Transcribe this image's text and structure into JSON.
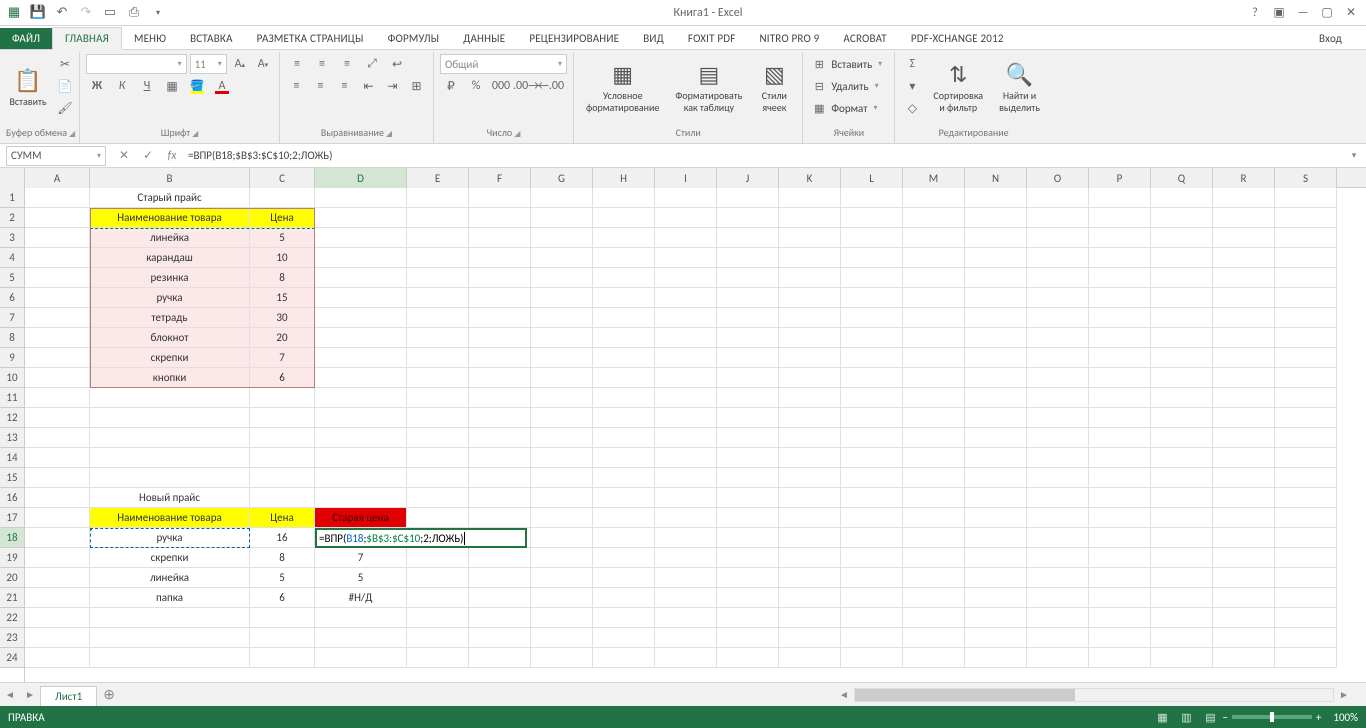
{
  "app": {
    "title": "Книга1 - Excel"
  },
  "qat": [
    "excel",
    "save",
    "undo",
    "redo",
    "doc",
    "print",
    "dd"
  ],
  "wincontrols": [
    "help",
    "ribbon-toggle",
    "minimize",
    "restore",
    "close"
  ],
  "tabs": {
    "file": "ФАЙЛ",
    "items": [
      "ГЛАВНАЯ",
      "Меню",
      "ВСТАВКА",
      "РАЗМЕТКА СТРАНИЦЫ",
      "ФОРМУЛЫ",
      "ДАННЫЕ",
      "РЕЦЕНЗИРОВАНИЕ",
      "ВИД",
      "Foxit PDF",
      "NITRO PRO 9",
      "ACROBAT",
      "PDF-XChange 2012"
    ],
    "active": "ГЛАВНАЯ",
    "login": "Вход"
  },
  "ribbon": {
    "clipboard": {
      "paste": "Вставить",
      "label": "Буфер обмена"
    },
    "font": {
      "label": "Шрифт",
      "size": "11",
      "fontname": ""
    },
    "alignment": {
      "label": "Выравнивание"
    },
    "number": {
      "label": "Число",
      "format": "Общий"
    },
    "styles": {
      "label": "Стили",
      "cond": "Условное\nформатирование",
      "table": "Форматировать\nкак таблицу",
      "cell": "Стили\nячеек"
    },
    "cells": {
      "label": "Ячейки",
      "insert": "Вставить",
      "delete": "Удалить",
      "format": "Формат"
    },
    "editing": {
      "label": "Редактирование",
      "sort": "Сортировка\nи фильтр",
      "find": "Найти и\nвыделить"
    }
  },
  "formula": {
    "namebox": "СУММ",
    "value": "=ВПР(B18;$B$3:$C$10;2;ЛОЖЬ)"
  },
  "columns": [
    "A",
    "B",
    "C",
    "D",
    "E",
    "F",
    "G",
    "H",
    "I",
    "J",
    "K",
    "L",
    "M",
    "N",
    "O",
    "P",
    "Q",
    "R",
    "S"
  ],
  "colwidths": {
    "A": 65,
    "B": 160,
    "C": 65,
    "D": 92,
    "default": 62
  },
  "rows_visible": 24,
  "data": {
    "B1": "Старый прайс",
    "B2": "Наименование товара",
    "C2": "Цена",
    "B3": "линейка",
    "C3": "5",
    "B4": "карандаш",
    "C4": "10",
    "B5": "резинка",
    "C5": "8",
    "B6": "ручка",
    "C6": "15",
    "B7": "тетрадь",
    "C7": "30",
    "B8": "блокнот",
    "C8": "20",
    "B9": "скрепки",
    "C9": "7",
    "B10": "кнопки",
    "C10": "6",
    "B16": "Новый прайс",
    "B17": "Наименование товара",
    "C17": "Цена",
    "D17": "Старая цена",
    "B18": "ручка",
    "C18": "16",
    "B19": "скрепки",
    "C19": "8",
    "D19": "7",
    "B20": "линейка",
    "C20": "5",
    "D20": "5",
    "B21": "папка",
    "C21": "6",
    "D21": "#Н/Д"
  },
  "edit_cell": {
    "ref": "D18",
    "parts": [
      {
        "t": "=ВПР(",
        "c": "black"
      },
      {
        "t": "B18",
        "c": "blue"
      },
      {
        "t": ";",
        "c": "black"
      },
      {
        "t": "$B$3:$C$10",
        "c": "green"
      },
      {
        "t": ";2;ЛОЖЬ)",
        "c": "black"
      }
    ]
  },
  "sheets": {
    "active": "Лист1"
  },
  "status": {
    "mode": "ПРАВКА",
    "zoom": "100%"
  }
}
